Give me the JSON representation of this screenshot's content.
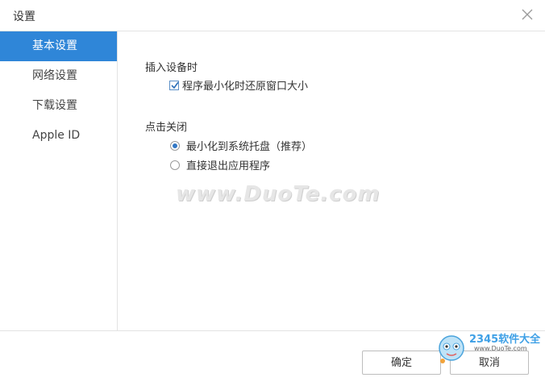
{
  "window": {
    "title": "设置"
  },
  "sidebar": {
    "items": [
      {
        "label": "基本设置",
        "active": true
      },
      {
        "label": "网络设置",
        "active": false
      },
      {
        "label": "下载设置",
        "active": false
      },
      {
        "label": "Apple ID",
        "active": false
      }
    ]
  },
  "content": {
    "device_section": {
      "title": "插入设备时",
      "checkbox_label": "程序最小化时还原窗口大小",
      "checked": true
    },
    "close_section": {
      "title": "点击关闭",
      "options": [
        {
          "label": "最小化到系统托盘（推荐）",
          "selected": true
        },
        {
          "label": "直接退出应用程序",
          "selected": false
        }
      ]
    }
  },
  "footer": {
    "ok_label": "确定",
    "cancel_label": "取消"
  },
  "watermark": {
    "text": "www.DuoTe.com"
  },
  "logo": {
    "text": "2345软件大全",
    "url": "www.DuoTe.com"
  },
  "colors": {
    "accent": "#2f86d8",
    "border": "#e3e3e3"
  }
}
